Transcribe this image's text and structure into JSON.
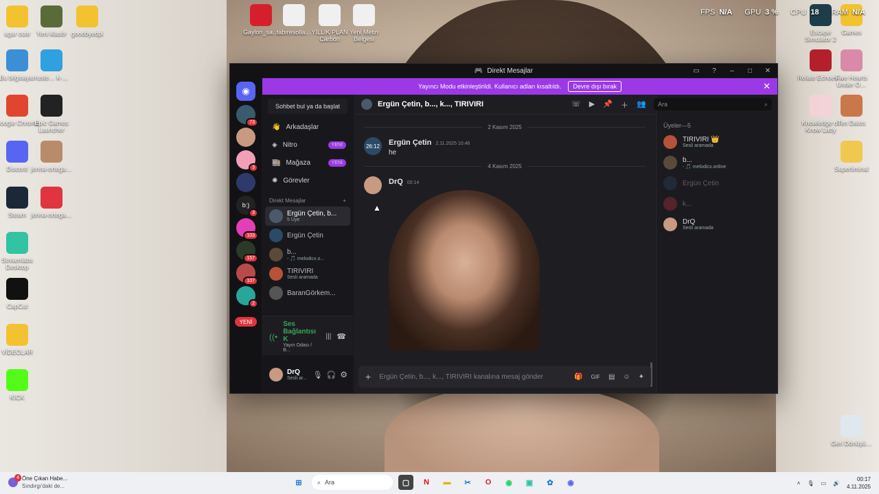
{
  "desktop": {
    "icons_left": [
      {
        "label": "ugur cute",
        "color": "#f2c230"
      },
      {
        "label": "Yeni klasör",
        "color": "#5a6b3a"
      },
      {
        "label": "goodbyedpi",
        "color": "#f2c230"
      },
      {
        "label": "Bu bilgisayar",
        "color": "#3a8fd6"
      },
      {
        "label": "ruste… k-…",
        "color": "#2fa0e0"
      },
      {
        "label": "Google Chrome",
        "color": "#e2452f"
      },
      {
        "label": "Epic Games Launcher",
        "color": "#222222"
      },
      {
        "label": "Discord",
        "color": "#5865f2"
      },
      {
        "label": "jenna-ortega…",
        "color": "#b88b6b"
      },
      {
        "label": "Steam",
        "color": "#1b2838"
      },
      {
        "label": "jenna-ortega…",
        "color": "#e0343f"
      },
      {
        "label": "Streamlabs Desktop",
        "color": "#31c3a2"
      },
      {
        "label": "CapCut",
        "color": "#111111"
      },
      {
        "label": "VİDEOLAR",
        "color": "#f2c230"
      },
      {
        "label": "KICK",
        "color": "#53fc18"
      }
    ],
    "icons_top": [
      {
        "label": "Gaylon_sa…",
        "color": "#d61f2c"
      },
      {
        "label": "tabıresolla…",
        "color": "#f0f0f0"
      },
      {
        "label": "YILLIK PLAN Carbon",
        "color": "#f0f0f0"
      },
      {
        "label": "Yeni Metin Belgesi",
        "color": "#f0f0f0"
      }
    ],
    "icons_right": [
      {
        "label": "Escape Simulator 2",
        "color": "#1e3d4a"
      },
      {
        "label": "Games",
        "color": "#f2c230"
      },
      {
        "label": "Relate Echoes…",
        "color": "#b3202c"
      },
      {
        "label": "Five Hearts Under O…",
        "color": "#d98aa8"
      },
      {
        "label": "Knowledge or Know Lady",
        "color": "#f3d3d8"
      },
      {
        "label": "Ten Dates",
        "color": "#c9774b"
      },
      {
        "label": "Superliminal",
        "color": "#f0c850"
      },
      {
        "label": "Geri Dönüşü…",
        "color": "#dfe8ef"
      }
    ],
    "sysinfo": {
      "fps_label": "FPS",
      "fps_value": "N/A",
      "gpu_label": "GPU",
      "gpu_value": "3 %",
      "cpu_label": "CPU",
      "cpu_value": "18",
      "ram_label": "RAM",
      "ram_value": "N/A"
    }
  },
  "window": {
    "title": "Direkt Mesajlar",
    "banner_text": "Yayıncı Modu etkinleştirildi. Kullanıcı adları kısaltıldı.",
    "banner_button": "Devre dışı bırak",
    "servers": [
      {
        "badge": "73",
        "color": "#3a5a6e"
      },
      {
        "badge": "",
        "color": "#c99a82"
      },
      {
        "badge": "3",
        "color": "#f2a0b6"
      },
      {
        "badge": "",
        "color": "#2e3a6a"
      },
      {
        "badge": "3",
        "color": "#222222",
        "text": "b:)"
      },
      {
        "badge": "103",
        "color": "#e23fb8"
      },
      {
        "badge": "157",
        "color": "#2a3a2a"
      },
      {
        "badge": "107",
        "color": "#b84a4a"
      },
      {
        "badge": "2",
        "color": "#2aa59a"
      }
    ],
    "server_new_label": "YENİ",
    "find_button": "Sohbet bul ya da başlat",
    "nav": [
      {
        "label": "Arkadaşlar",
        "badge": ""
      },
      {
        "label": "Nitro",
        "badge": "YENİ"
      },
      {
        "label": "Mağaza",
        "badge": "YENİ"
      },
      {
        "label": "Görevler",
        "badge": ""
      }
    ],
    "dm_section_title": "Direkt Mesajlar",
    "dm_add": "+",
    "dms": [
      {
        "name": "Ergün Çetin, b...",
        "sub": "5 Üye",
        "color": "#4a5a6a",
        "active": true
      },
      {
        "name": "Ergün Çetin",
        "sub": "",
        "color": "#2c4a66",
        "active": false
      },
      {
        "name": "b...",
        "sub": "- 🎵 melodicx.o...",
        "color": "#5a4a3a",
        "active": false
      },
      {
        "name": "TIRIVIRI",
        "sub": "Sesli aramada",
        "color": "#b5533a",
        "active": false
      },
      {
        "name": "BaranGörkem...",
        "sub": "",
        "color": "#555555",
        "active": false
      }
    ],
    "voice": {
      "title": "Ses Bağlantısı K",
      "sub": "Yayın Odası / B..."
    },
    "user": {
      "name": "DrQ",
      "sub": "Sesli ar..."
    },
    "chat": {
      "title": "Ergün Çetin, b..., k..., TIRIVIRI",
      "search_placeholder": "Ara",
      "messages": [
        {
          "type": "divider",
          "text": "2 Kasım 2025"
        },
        {
          "type": "msg",
          "author": "Ergün Çetin",
          "time": "2.11.2025 10:46",
          "text": "he",
          "avatar_text": "26:12",
          "avatar_color": "#2c4a66"
        },
        {
          "type": "divider",
          "text": "4 Kasım 2025"
        },
        {
          "type": "msg",
          "author": "DrQ",
          "time": "00:14",
          "text": "",
          "avatar_text": "",
          "avatar_color": "#c99a82",
          "image": true
        }
      ],
      "composer_placeholder": "Ergün Çetin, b..., k..., TIRIVIRI kanalına mesaj gönder"
    },
    "members_title": "Üyeler—5",
    "members": [
      {
        "name": "TIRIVIRI 👑",
        "sub": "Sesli aramada",
        "color": "#b5533a",
        "dim": false
      },
      {
        "name": "b...",
        "sub": "- 🎵 melodicx.online",
        "color": "#5a4a3a",
        "dim": false
      },
      {
        "name": "Ergün Çetin",
        "sub": "",
        "color": "#2c4a66",
        "dim": true
      },
      {
        "name": "k...",
        "sub": "",
        "color": "#c2343c",
        "dim": true
      },
      {
        "name": "DrQ",
        "sub": "Sesli aramada",
        "color": "#c99a82",
        "dim": false
      }
    ]
  },
  "taskbar": {
    "news_title": "Öne Çıkan Habe...",
    "news_sub": "Sındırgı'daki de...",
    "news_badge": "4",
    "search_label": "Ara",
    "time": "00:17",
    "date": "4.11.2025"
  }
}
